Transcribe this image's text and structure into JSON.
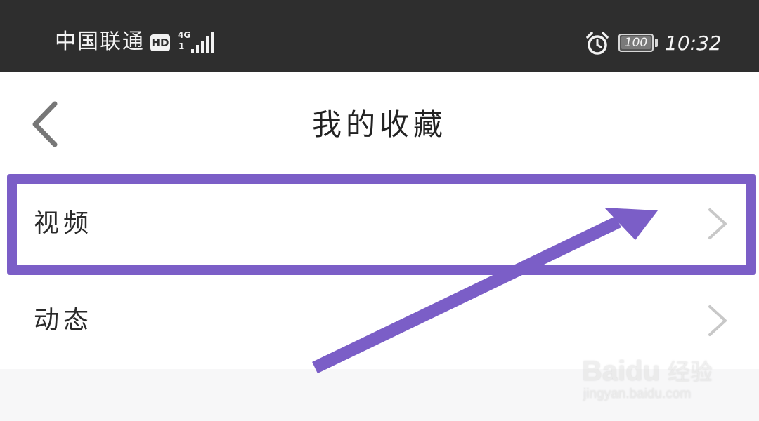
{
  "status_bar": {
    "carrier": "中国联通",
    "hd_badge": "HD",
    "network_type": "4G",
    "network_sub": "1",
    "battery_level": "100",
    "battery_fraction": 1.0,
    "time": "10:32",
    "signal_bars": 5,
    "icons": {
      "alarm": "alarm-clock-icon",
      "signal": "signal-strength-icon",
      "battery": "battery-icon"
    }
  },
  "header": {
    "title": "我的收藏",
    "back_icon": "chevron-left-icon"
  },
  "list": {
    "items": [
      {
        "label": "视频",
        "icon": "chevron-right-icon",
        "highlighted": true
      },
      {
        "label": "动态",
        "icon": "chevron-right-icon",
        "highlighted": false
      }
    ]
  },
  "annotation": {
    "color": "#7b5ec7"
  },
  "watermark": {
    "brand": "Baidu",
    "cn": "经验",
    "url": "jingyan.baidu.com"
  },
  "colors": {
    "status_bar_bg": "#2e2e2e",
    "page_bg": "#ffffff",
    "footer_bg": "#f7f7f8",
    "chevron": "#c8c8c8",
    "back_chevron": "#777777"
  }
}
